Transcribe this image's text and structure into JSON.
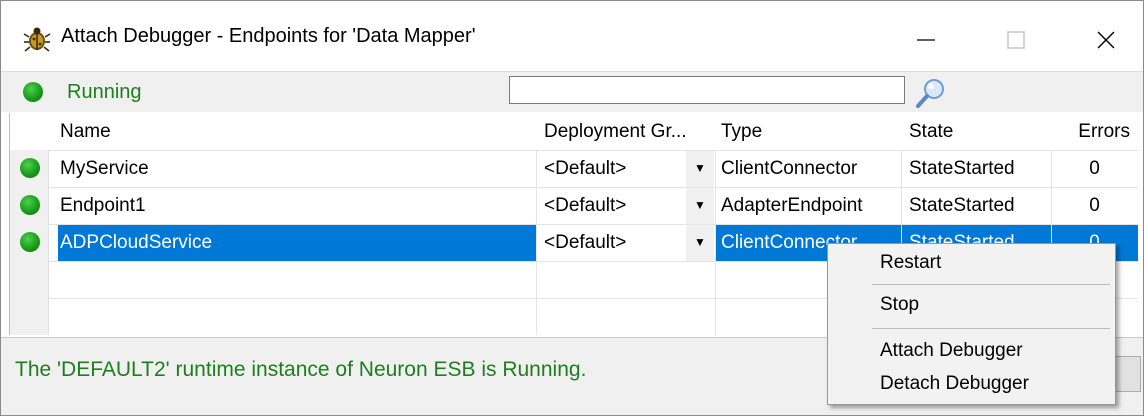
{
  "window": {
    "title": "Attach Debugger - Endpoints for 'Data Mapper'",
    "app_icon": "bug-icon",
    "controls": [
      "minimize-icon",
      "maximize-icon",
      "close-icon"
    ]
  },
  "toolbar": {
    "status_label": "Running",
    "status_color": "#1e7e1e",
    "search": {
      "value": "",
      "placeholder": ""
    },
    "search_icon": "magnifier-icon"
  },
  "grid": {
    "columns": [
      "Name",
      "Deployment Gr...",
      "Type",
      "State",
      "Errors"
    ],
    "rows": [
      {
        "name": "MyService",
        "group": "<Default>",
        "type": "ClientConnector",
        "state": "StateStarted",
        "errors": "0",
        "selected": false
      },
      {
        "name": "Endpoint1",
        "group": "<Default>",
        "type": "AdapterEndpoint",
        "state": "StateStarted",
        "errors": "0",
        "selected": false
      },
      {
        "name": "ADPCloudService",
        "group": "<Default>",
        "type": "ClientConnector",
        "state": "StateStarted",
        "errors": "0",
        "selected": true
      }
    ],
    "selection_color": "#0078d7"
  },
  "status_bar": {
    "message": "The 'DEFAULT2' runtime instance of Neuron ESB is Running."
  },
  "context_menu": {
    "items": [
      "Restart",
      "Stop",
      "Attach Debugger",
      "Detach Debugger"
    ]
  }
}
